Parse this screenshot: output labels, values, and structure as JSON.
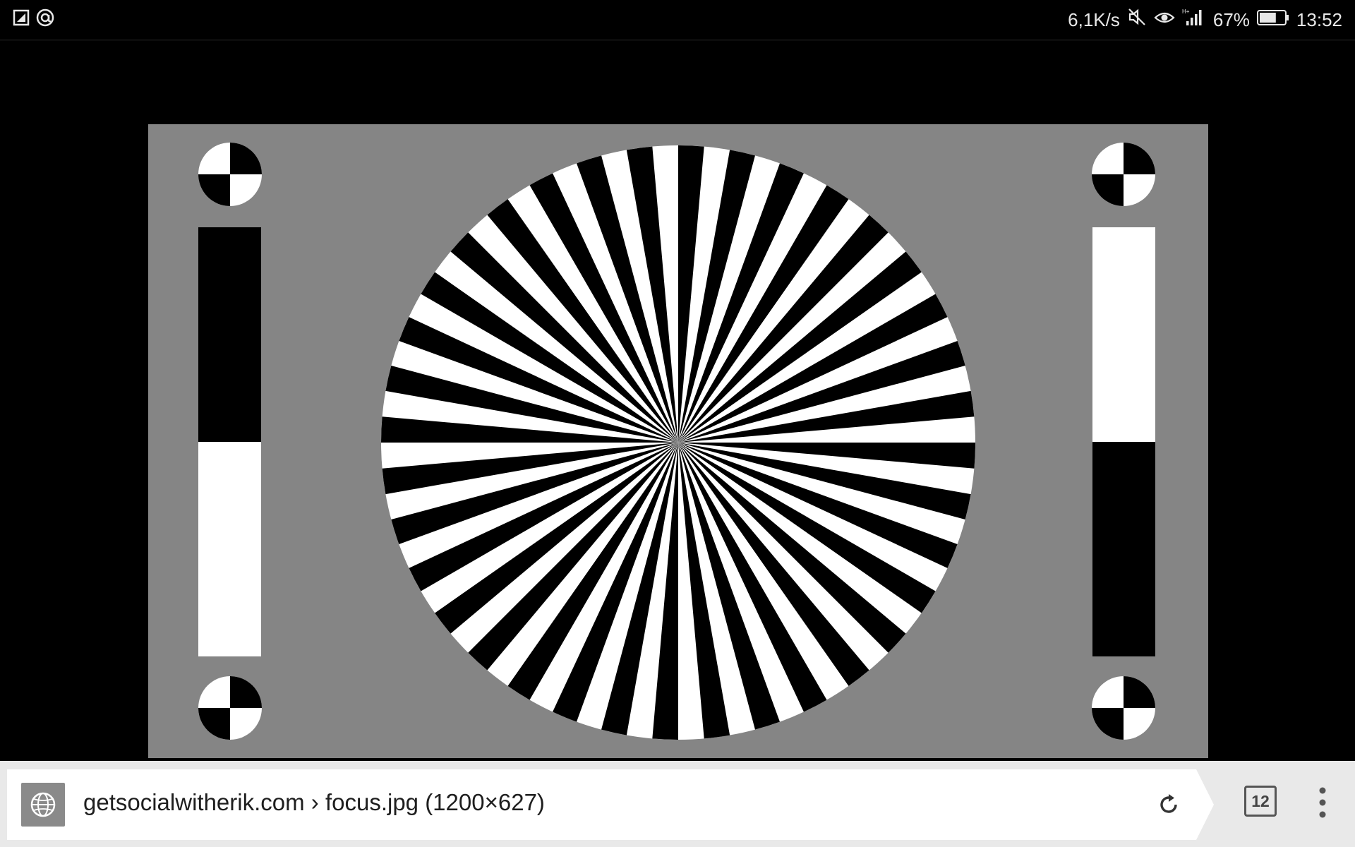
{
  "status_bar": {
    "left_icons": [
      "notification-icon",
      "at-icon"
    ],
    "network_speed": "6,1K/s",
    "icons": [
      "mute-icon",
      "eye-icon",
      "signal-icon",
      "battery-icon"
    ],
    "battery": "67%",
    "battery_level": 0.67,
    "time": "13:52"
  },
  "image": {
    "name": "focus-chart",
    "background_color": "#858585",
    "starburst_segments": 72,
    "left_bar": [
      "#000000",
      "#ffffff"
    ],
    "right_bar": [
      "#ffffff",
      "#000000"
    ]
  },
  "address_bar": {
    "site_icon": "globe-icon",
    "url": "getsocialwitherik.com › focus.jpg (1200×627)",
    "reload_icon": "reload-icon",
    "tab_count": "12",
    "menu_icon": "more-vertical-icon"
  }
}
